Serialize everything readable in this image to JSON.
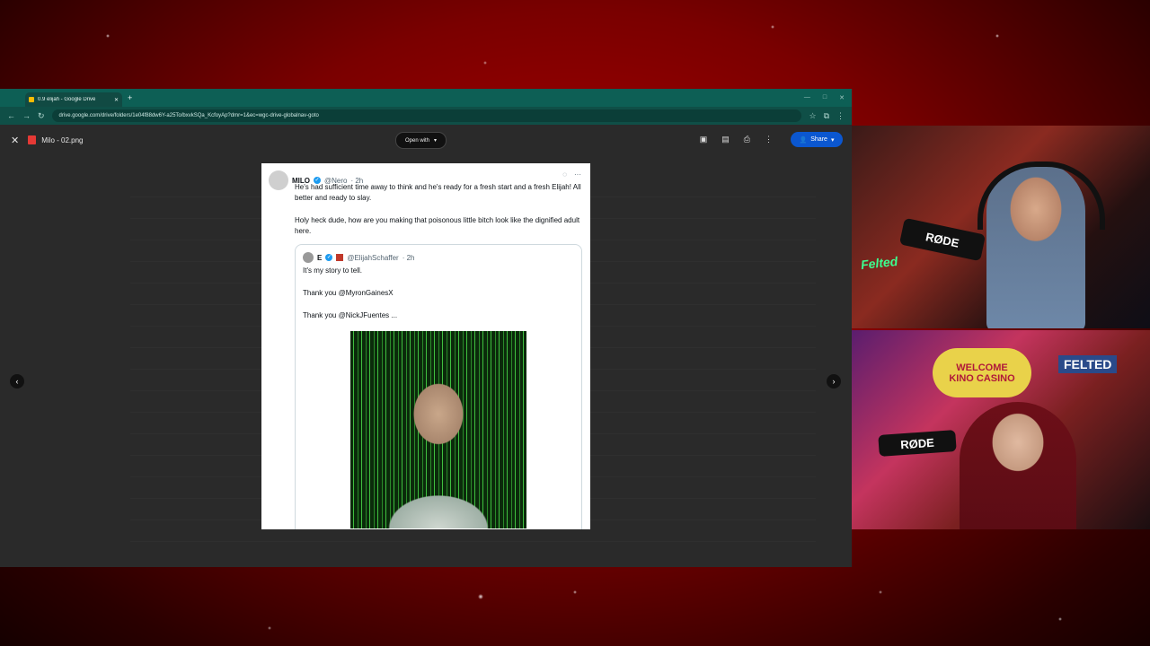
{
  "browser": {
    "tab_title": "0.9 elijah - Google Drive",
    "url": "drive.google.com/drive/folders/1e04f88dw6Y-a25To/bxvkSQa_KcfoyAp?dmr=1&ec=wgc-drive-globalnav-goto"
  },
  "viewer": {
    "file_name": "Milo - 02.png",
    "open_with_label": "Open with",
    "share_label": "Share"
  },
  "tweet": {
    "author_name": "MILO",
    "author_handle": "@Nero",
    "time": "· 2h",
    "text_1": "He's had sufficient time away to think and he's ready for a fresh start and a fresh Elijah! All better and ready to slay.",
    "text_2": "Holy heck dude, how are you making that poisonous little bitch look like the dignified adult here.",
    "quote": {
      "name": "E",
      "handle": "@ElijahSchaffer",
      "time": "· 2h",
      "line_1": "It's my story to tell.",
      "line_2": "Thank you @MyronGainesX",
      "line_3": "Thank you @NickJFuentes ..."
    }
  },
  "webcams": {
    "mic_brand": "RØDE",
    "sign_top": "WELCOME",
    "sign_bottom": "KINO CASINO",
    "felted": "FELTED"
  },
  "icons": [
    "close-icon",
    "search-icon",
    "refresh-icon",
    "star-icon",
    "extensions-icon",
    "menu-icon",
    "add-to-drive-icon",
    "comment-icon",
    "print-icon",
    "more-icon",
    "chevron-left-icon",
    "chevron-right-icon",
    "zoom-out-icon",
    "zoom-icon",
    "zoom-in-icon",
    "verified-icon"
  ]
}
